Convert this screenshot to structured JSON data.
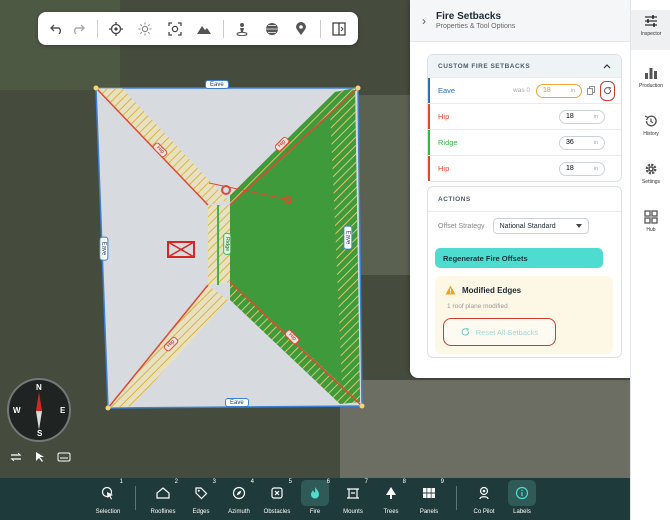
{
  "toolbar": {
    "undo_icon": "undo-icon",
    "redo_icon": "redo-icon",
    "tools": [
      "target-icon",
      "sun-icon",
      "focus-icon",
      "terrain-icon",
      "person-icon",
      "sphere-icon",
      "map-pin-icon",
      "split-view-icon"
    ]
  },
  "canvas": {
    "edge_labels": {
      "eave_top": "Eave",
      "eave_bottom": "Eave",
      "eave_left": "Eave",
      "eave_right": "Eave",
      "hip1": "Hip",
      "hip2": "Hip",
      "hip3": "Hip",
      "hip4": "Hip",
      "ridge": "Ridge"
    },
    "compass": {
      "north": "N",
      "south": "S",
      "east": "E",
      "west": "W"
    }
  },
  "panel": {
    "title": "Fire Setbacks",
    "subtitle": "Properties & Tool Options",
    "custom_section": {
      "heading": "CUSTOM FIRE SETBACKS",
      "rows": [
        {
          "name": "Eave",
          "color": "#2f6fb5",
          "was": "was 0",
          "value": "18",
          "unit": "in"
        },
        {
          "name": "Hip",
          "color": "#e0492f",
          "value": "18",
          "unit": "in"
        },
        {
          "name": "Ridge",
          "color": "#3bb54a",
          "value": "36",
          "unit": "in"
        },
        {
          "name": "Hip",
          "color": "#e0492f",
          "value": "18",
          "unit": "in"
        }
      ]
    },
    "actions": {
      "heading": "ACTIONS",
      "offset_label": "Offset Strategy",
      "offset_value": "National Standard",
      "regenerate_button": "Regenerate Fire Offsets",
      "modified_title": "Modified Edges",
      "modified_desc": "1 roof plane modified",
      "reset_button": "Reset All Setbacks"
    }
  },
  "rail": [
    {
      "label": "Inspector",
      "icon": "sliders-icon",
      "active": true
    },
    {
      "label": "Production",
      "icon": "bar-chart-icon",
      "active": false
    },
    {
      "label": "History",
      "icon": "history-icon",
      "active": false
    },
    {
      "label": "Settings",
      "icon": "gear-icon",
      "active": false
    },
    {
      "label": "Hub",
      "icon": "grid-icon",
      "active": false
    }
  ],
  "bottom": [
    {
      "label": "Selection",
      "num": "1"
    },
    {
      "label": "Rooflines",
      "num": "2"
    },
    {
      "label": "Edges",
      "num": "3"
    },
    {
      "label": "Azimuth",
      "num": "4"
    },
    {
      "label": "Obstacles",
      "num": "5"
    },
    {
      "label": "Fire",
      "num": "6",
      "active": true
    },
    {
      "label": "Mounts",
      "num": "7"
    },
    {
      "label": "Trees",
      "num": "8"
    },
    {
      "label": "Panels",
      "num": "9"
    },
    {
      "label": "Co Pilot",
      "num": ""
    },
    {
      "label": "Labels",
      "num": "",
      "active": true
    }
  ],
  "colors": {
    "accent": "#4fdcd0",
    "highlight": "#d13b2e",
    "green_plane": "#3f9a3c",
    "setback_hatch": "#e8d07a"
  }
}
